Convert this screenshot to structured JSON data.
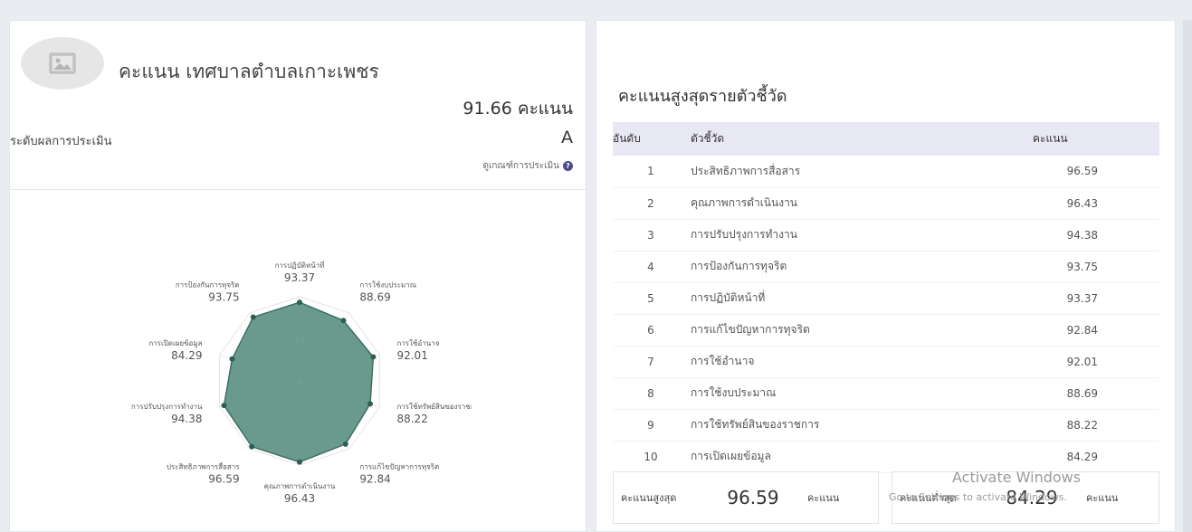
{
  "org": {
    "title": "คะแนน เทศบาลตำบลเกาะเพชร",
    "score": "91.66",
    "score_unit": "คะแนน",
    "level_label": "ระดับผลการประเมิน",
    "level_grade": "A",
    "criteria_link": "ดูเกณฑ์การประเมิน"
  },
  "chart_data": {
    "type": "radar",
    "axes": [
      "การปฏิบัติหน้าที่",
      "การใช้งบประมาณ",
      "การใช้อำนาจ",
      "การใช้ทรัพย์สินของราชการ",
      "การแก้ไขปัญหาการทุจริต",
      "คุณภาพการดำเนินงาน",
      "ประสิทธิภาพการสื่อสาร",
      "การปรับปรุงการทำงาน",
      "การเปิดเผยข้อมูล",
      "การป้องกันการทุจริต"
    ],
    "values": [
      93.37,
      88.69,
      92.01,
      88.22,
      92.84,
      96.43,
      96.59,
      94.38,
      84.29,
      93.75
    ],
    "value_labels": [
      "93.37",
      "88.69",
      "92.01",
      "88.22",
      "92.84",
      "96.43",
      "96.59",
      "94.38",
      "84.29",
      "93.75"
    ],
    "range": [
      0,
      100
    ],
    "ticks": [
      "0",
      "50"
    ],
    "fill_color": "#5a8f82",
    "stroke_color": "#3e6f63"
  },
  "ranking": {
    "title": "คะแนนสูงสุดรายตัวชี้วัด",
    "headers": {
      "rank": "อันดับ",
      "indicator": "ตัวชี้วัด",
      "score": "คะแนน"
    },
    "rows": [
      {
        "rank": "1",
        "indicator": "ประสิทธิภาพการสื่อสาร",
        "score": "96.59"
      },
      {
        "rank": "2",
        "indicator": "คุณภาพการดำเนินงาน",
        "score": "96.43"
      },
      {
        "rank": "3",
        "indicator": "การปรับปรุงการทำงาน",
        "score": "94.38"
      },
      {
        "rank": "4",
        "indicator": "การป้องกันการทุจริต",
        "score": "93.75"
      },
      {
        "rank": "5",
        "indicator": "การปฏิบัติหน้าที่",
        "score": "93.37"
      },
      {
        "rank": "6",
        "indicator": "การแก้ไขปัญหาการทุจริต",
        "score": "92.84"
      },
      {
        "rank": "7",
        "indicator": "การใช้อำนาจ",
        "score": "92.01"
      },
      {
        "rank": "8",
        "indicator": "การใช้งบประมาณ",
        "score": "88.69"
      },
      {
        "rank": "9",
        "indicator": "การใช้ทรัพย์สินของราชการ",
        "score": "88.22"
      },
      {
        "rank": "10",
        "indicator": "การเปิดเผยข้อมูล",
        "score": "84.29"
      }
    ]
  },
  "summary": {
    "max_label": "คะแนนสูงสุด",
    "max_value": "96.59",
    "min_label": "คะแนนต่ำสุด",
    "min_value": "84.29",
    "unit": "คะแนน"
  },
  "watermark": {
    "line1": "Activate Windows",
    "line2": "Go to Settings to activate Windows."
  },
  "icons": {
    "avatar": "image-placeholder-icon",
    "help": "question-circle-icon"
  }
}
